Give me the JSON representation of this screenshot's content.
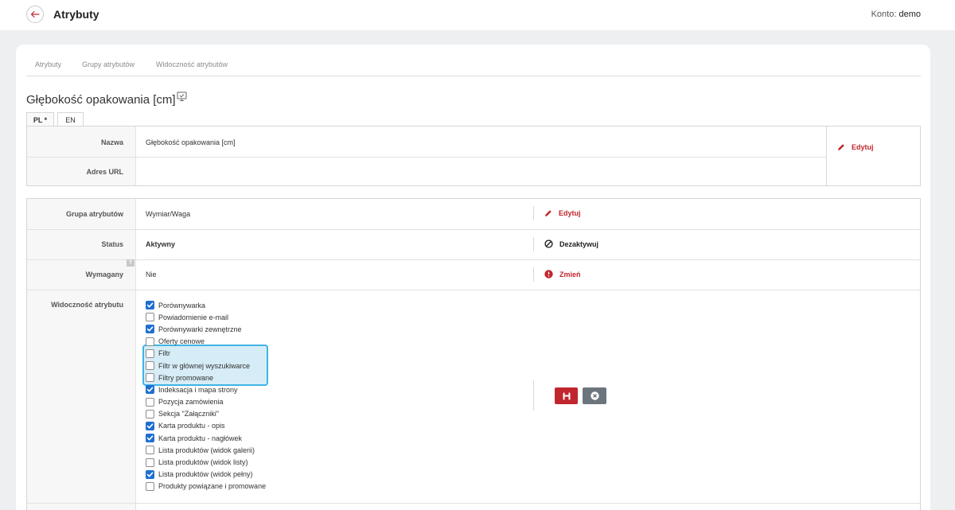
{
  "header": {
    "title": "Atrybuty",
    "account_label": "Konto:",
    "account_name": "demo"
  },
  "nav_tabs": [
    "Atrybuty",
    "Grupy atrybutów",
    "Widoczność atrybutów"
  ],
  "attribute": {
    "title": "Głębokość opakowania [cm]"
  },
  "lang_tabs": [
    "PL *",
    "EN"
  ],
  "name_section": {
    "name_label": "Nazwa",
    "name_value": "Głębokość opakowania [cm]",
    "url_label": "Adres URL",
    "url_value": "",
    "edit_label": "Edytuj"
  },
  "details": {
    "group_label": "Grupa atrybutów",
    "group_value": "Wymiar/Waga",
    "group_action": "Edytuj",
    "status_label": "Status",
    "status_value": "Aktywny",
    "status_action": "Dezaktywuj",
    "required_help": "?",
    "required_label": "Wymagany",
    "required_value": "Nie",
    "required_action": "Zmień",
    "visibility_label": "Widoczność atrybutu"
  },
  "visibility_options": [
    {
      "label": "Porównywarka",
      "checked": true
    },
    {
      "label": "Powiadomienie e-mail",
      "checked": false
    },
    {
      "label": "Porównywarki zewnętrzne",
      "checked": true
    },
    {
      "label": "Oferty cenowe",
      "checked": false
    },
    {
      "label": "Filtr",
      "checked": false
    },
    {
      "label": "Filtr w głównej wyszukiwarce",
      "checked": false
    },
    {
      "label": "Filtry promowane",
      "checked": false
    },
    {
      "label": "Indeksacja i mapa strony",
      "checked": true
    },
    {
      "label": "Pozycja zamówienia",
      "checked": false
    },
    {
      "label": "Sekcja \"Załączniki\"",
      "checked": false
    },
    {
      "label": "Karta produktu - opis",
      "checked": true
    },
    {
      "label": "Karta produktu - nagłówek",
      "checked": true
    },
    {
      "label": "Lista produktów (widok galerii)",
      "checked": false
    },
    {
      "label": "Lista produktów (widok listy)",
      "checked": false
    },
    {
      "label": "Lista produktów (widok pełny)",
      "checked": true
    },
    {
      "label": "Produkty powiązane i promowane",
      "checked": false
    }
  ],
  "colors": {
    "accent_red": "#c0262d",
    "checkbox_blue": "#1f6fd1",
    "highlight_border": "#3fb4e5",
    "cancel_gray": "#6c757d"
  }
}
